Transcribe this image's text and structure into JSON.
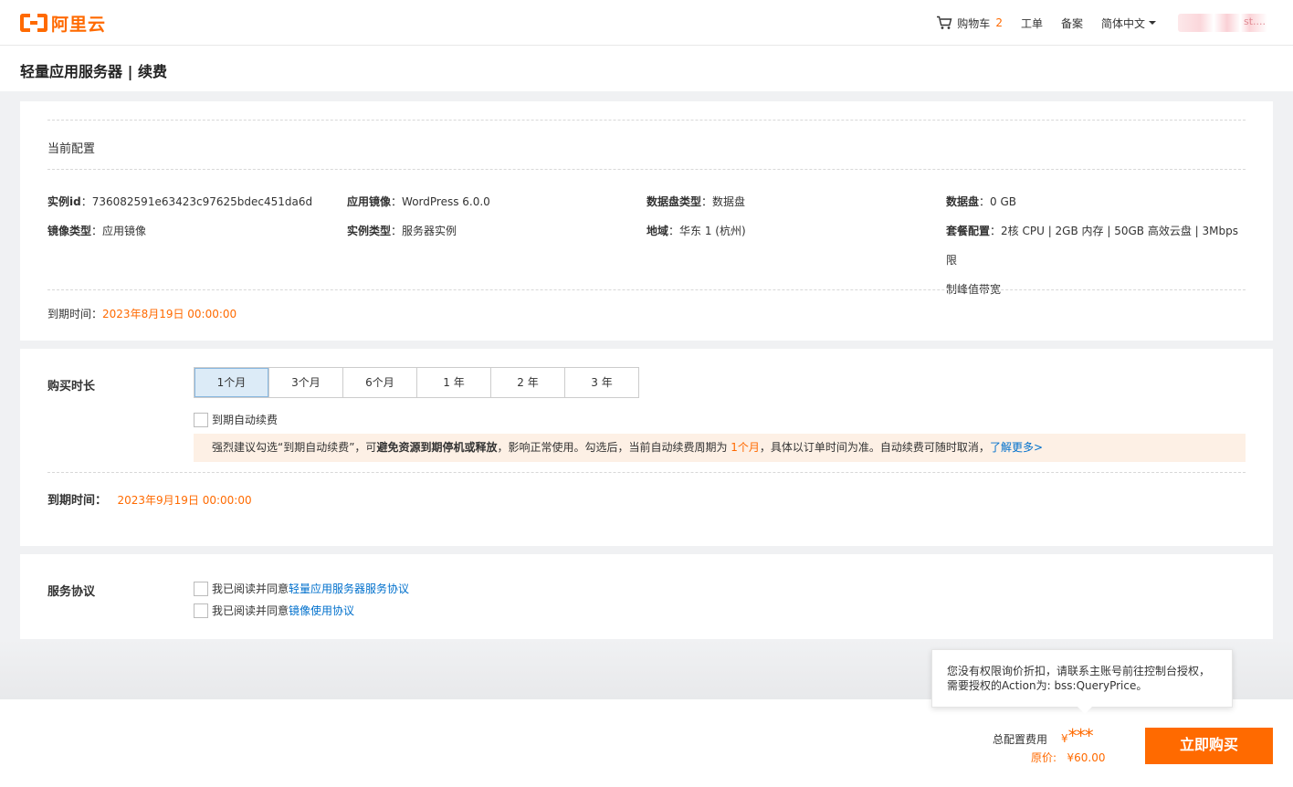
{
  "logo": {
    "text": "阿里云"
  },
  "nav": {
    "cart_label": "购物车",
    "cart_count": "2",
    "ticket": "工单",
    "record": "备案",
    "language": "简体中文",
    "account": "st...."
  },
  "page": {
    "title": "轻量应用服务器 | 续费"
  },
  "current_config": {
    "title": "当前配置",
    "items": [
      {
        "key": "实例id",
        "value": "736082591e63423c97625bdec451da6d"
      },
      {
        "key": "应用镜像",
        "value": "WordPress 6.0.0"
      },
      {
        "key": "数据盘类型",
        "value": "数据盘"
      },
      {
        "key": "数据盘",
        "value": "0 GB"
      },
      {
        "key": "镜像类型",
        "value": "应用镜像"
      },
      {
        "key": "实例类型",
        "value": "服务器实例"
      },
      {
        "key": "地域",
        "value": "华东 1 (杭州)"
      },
      {
        "key": "套餐配置",
        "value": "2核 CPU | 2GB 内存 | 50GB 高效云盘 | 3Mbps 限",
        "value2": "制峰值带宽"
      }
    ],
    "expire_label": "到期时间",
    "expire_value": "2023年8月19日 00:00:00"
  },
  "purchase": {
    "title": "购买时长",
    "durations": [
      "1个月",
      "3个月",
      "6个月",
      "1 年",
      "2 年",
      "3 年"
    ],
    "selected": "1个月",
    "auto_renew_label": "到期自动续费",
    "notice": {
      "part1": "强烈建议勾选“到期自动续费”，可",
      "bold": "避免资源到期停机或释放",
      "part2": "，影响正常使用。勾选后，当前自动续费周期为 ",
      "period": "1个月",
      "part3": "，具体以订单时间为准。自动续费可随时取消，",
      "link": "了解更多>"
    },
    "expire_label": "到期时间：",
    "expire_value": "2023年9月19日 00:00:00"
  },
  "agreement": {
    "title": "服务协议",
    "items": [
      {
        "prefix": "我已阅读并同意",
        "link": "轻量应用服务器服务协议"
      },
      {
        "prefix": "我已阅读并同意",
        "link": "镜像使用协议"
      }
    ]
  },
  "footer": {
    "tooltip_line1": "您没有权限询价折扣，请联系主账号前往控制台授权，",
    "tooltip_line2": "需要授权的Action为: bss:QueryPrice。",
    "total_label": "总配置费用",
    "currency": "¥",
    "price_masked": "***",
    "original_label": "原价:",
    "original_value": "¥60.00",
    "buy_label": "立即购买"
  },
  "colors": {
    "accent": "#ff6a00",
    "link": "#0070cc",
    "notice_bg": "#fdf0e5"
  }
}
